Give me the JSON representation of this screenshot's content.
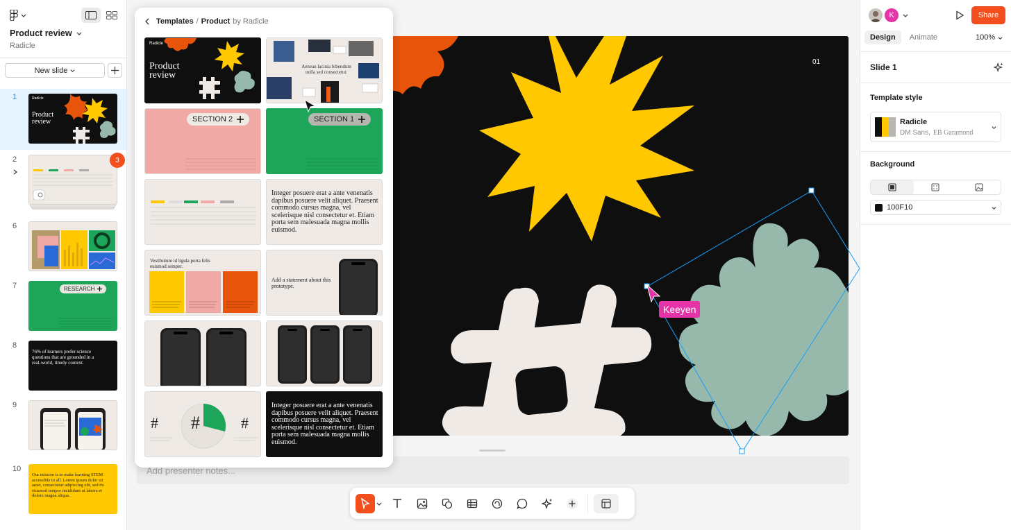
{
  "file": {
    "title": "Product review",
    "subtitle": "Radicle"
  },
  "slides_panel": {
    "new_slide_label": "New slide",
    "slides": [
      {
        "number": "1",
        "title_text": "Product review",
        "brand": "Radicle"
      },
      {
        "number": "2",
        "badge": "3"
      },
      {
        "number": "6"
      },
      {
        "number": "7",
        "label": "RESEARCH"
      },
      {
        "number": "8",
        "text": "76% of learners prefer science questions that are grounded in a real-world, timely context."
      },
      {
        "number": "9"
      },
      {
        "number": "10",
        "text": "Our mission is to make learning STEM accessible to all. Lorem ipsum dolor sit amet, consectetur adipiscing elit, sed do eiusmod tempor incididunt ut labore et dolore magna aliqua."
      }
    ]
  },
  "template_panel": {
    "breadcrumb_root": "Templates",
    "breadcrumb_sep": "/",
    "breadcrumb_current": "Product",
    "breadcrumb_by": "by Radicle",
    "cards": {
      "c1_brand": "Radicle",
      "c1_title": "Product review",
      "c2_text": "Aenean lacinia bibendum nulla sed consectetur.",
      "c3_label": "SECTION 2",
      "c4_label": "SECTION 1",
      "c6_text": "Integer posuere erat a ante venenatis dapibus posuere velit aliquet. Praesent commodo cursus magna, vel scelerisque nisl consectetur et. Etiam porta sem malesuada magna mollis euismod.",
      "c7_text": "Vestibulum id ligula porta felis euismod semper.",
      "c8_text": "Add a statement about this prototype.",
      "c11_glyph": "#",
      "c12_text": "Integer posuere erat a ante venenatis dapibus posuere velit aliquet. Praesent commodo cursus magna, vel scelerisque nisl consectetur et. Etiam porta sem malesuada magna mollis euismod."
    }
  },
  "canvas": {
    "page_number": "01",
    "cursor_label": "Keeyen",
    "presenter_notes_placeholder": "Add presenter notes..."
  },
  "toolbar": {
    "tools": [
      "move-tool",
      "text-tool",
      "image-tool",
      "shape-tool",
      "table-tool",
      "stamp-tool",
      "comment-tool",
      "ai-tool",
      "add-tool",
      "templates-tool"
    ]
  },
  "right_panel": {
    "avatar_letter": "K",
    "share_label": "Share",
    "tabs": [
      "Design",
      "Animate"
    ],
    "zoom": "100%",
    "slide_title": "Slide 1",
    "template_style_heading": "Template style",
    "template_style_name": "Radicle",
    "template_style_fonts": "DM Sans,",
    "template_style_fonts_serif": "EB Garamond",
    "background_heading": "Background",
    "background_color": "100F10"
  },
  "colors": {
    "accent": "#F24E1E",
    "slide_bg": "#100F10",
    "yellow": "#FFC800",
    "orange": "#E8540A",
    "sage": "#96B9AC",
    "cream": "#EFEAE5",
    "selection_blue": "#18A0FB",
    "cursor_pink": "#E633A8",
    "green": "#1DA659",
    "pink": "#F1A9A6"
  }
}
